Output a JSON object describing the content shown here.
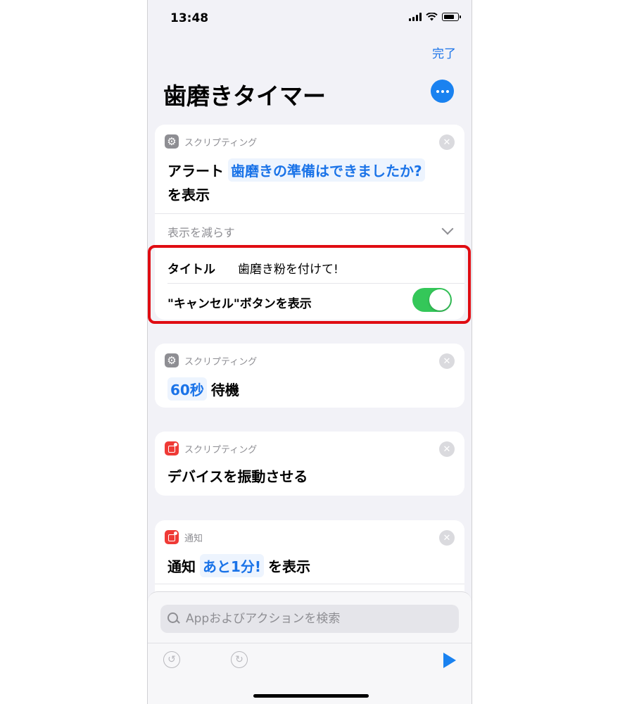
{
  "status_bar": {
    "time": "13:48"
  },
  "nav": {
    "done_label": "完了"
  },
  "page": {
    "title": "歯磨きタイマー"
  },
  "cards": [
    {
      "category": "スクリプティング",
      "verb": "アラート",
      "token": "歯磨きの準備はできましたか?",
      "suffix": "を表示",
      "show_less": "表示を減らす",
      "title_label": "タイトル",
      "title_value": "歯磨き粉を付けて!",
      "cancel_label": "\"キャンセル\"ボタンを表示",
      "cancel_toggle_on": true
    },
    {
      "category": "スクリプティング",
      "token": "60秒",
      "suffix": "待機"
    },
    {
      "category": "スクリプティング",
      "verb": "デバイスを振動させる"
    },
    {
      "category": "通知",
      "verb": "通知",
      "token": "あと1分!",
      "suffix": "を表示"
    }
  ],
  "search": {
    "placeholder": "Appおよびアクションを検索"
  },
  "colors": {
    "accent": "#1a82f0",
    "highlight": "#e00c12",
    "toggle_on": "#34c759"
  }
}
